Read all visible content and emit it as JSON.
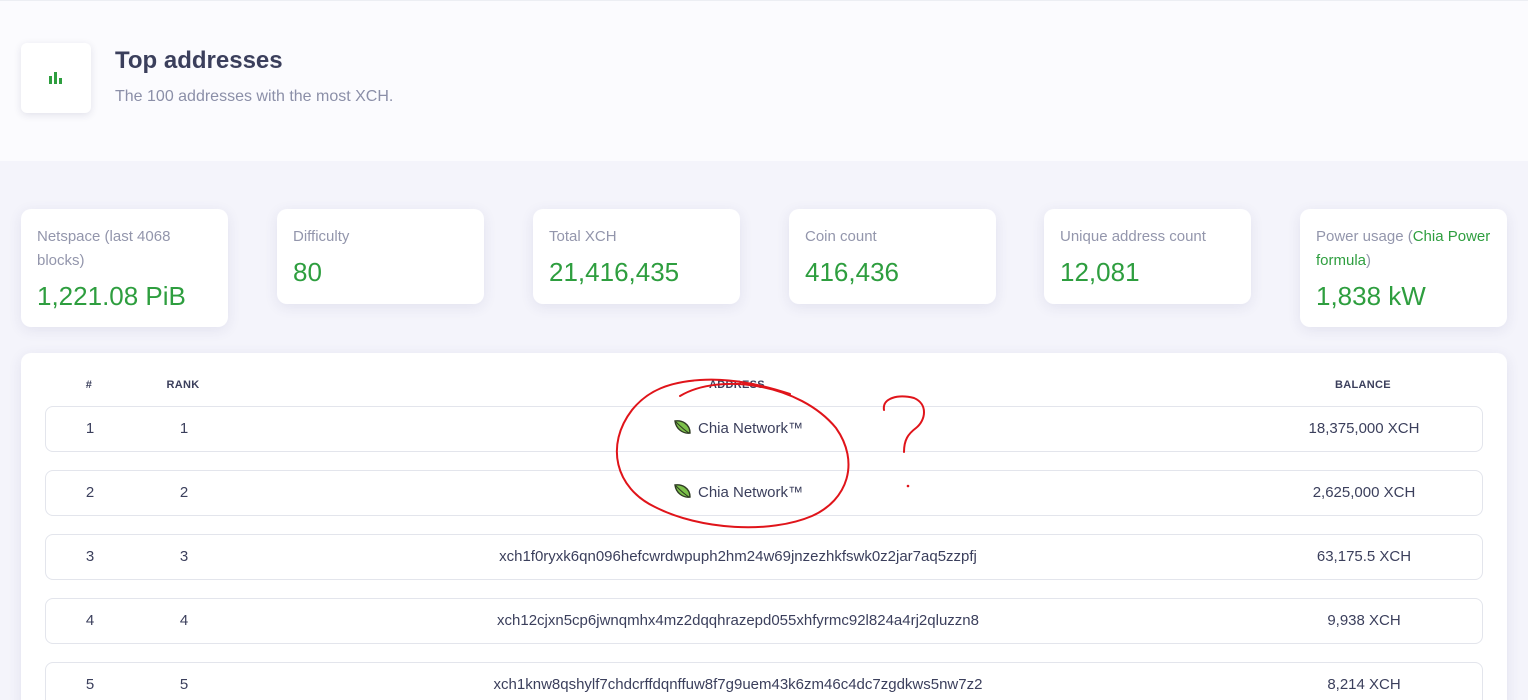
{
  "header": {
    "title": "Top addresses",
    "subtitle": "The 100 addresses with the most XCH.",
    "icon": "bar-chart-icon",
    "accent_color": "#2e9e3f"
  },
  "stats": [
    {
      "label": "Netspace (last 4068 blocks)",
      "value": "1,221.08 PiB"
    },
    {
      "label": "Difficulty",
      "value": "80"
    },
    {
      "label": "Total XCH",
      "value": "21,416,435"
    },
    {
      "label": "Coin count",
      "value": "416,436"
    },
    {
      "label": "Unique address count",
      "value": "12,081"
    },
    {
      "label_prefix": "Power usage (",
      "label_link": "Chia Power formula",
      "label_suffix": ")",
      "value": "1,838 kW"
    }
  ],
  "table": {
    "columns": [
      "#",
      "RANK",
      "ADDRESS",
      "BALANCE"
    ],
    "rows": [
      {
        "num": "1",
        "rank": "1",
        "address": "Chia Network™",
        "address_icon": "chia-leaf-icon",
        "balance": "18,375,000 XCH"
      },
      {
        "num": "2",
        "rank": "2",
        "address": "Chia Network™",
        "address_icon": "chia-leaf-icon",
        "balance": "2,625,000 XCH"
      },
      {
        "num": "3",
        "rank": "3",
        "address": "xch1f0ryxk6qn096hefcwrdwpuph2hm24w69jnzezhkfswk0z2jar7aq5zzpfj",
        "balance": "63,175.5 XCH"
      },
      {
        "num": "4",
        "rank": "4",
        "address": "xch12cjxn5cp6jwnqmhx4mz2dqqhrazepd055xhfyrmc92l824a4rj2qluzzn8",
        "balance": "9,938 XCH"
      },
      {
        "num": "5",
        "rank": "5",
        "address": "xch1knw8qshylf7chdcrffdqnffuw8f7g9uem43k6zm46c4dc7zgdkws5nw7z2",
        "balance": "8,214 XCH"
      }
    ]
  },
  "annotation": {
    "mark": "?",
    "color": "#e0141a"
  }
}
